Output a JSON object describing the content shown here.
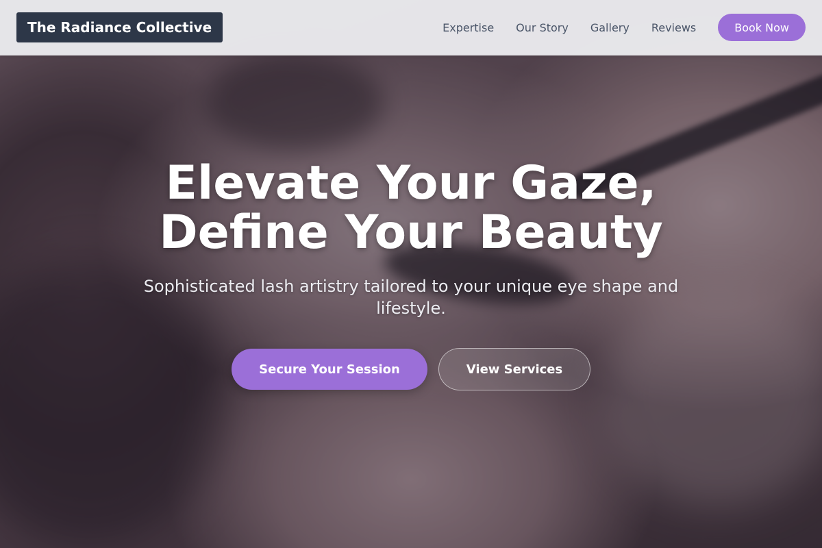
{
  "header": {
    "brand": "The Radiance Collective",
    "nav": [
      {
        "label": "Expertise"
      },
      {
        "label": "Our Story"
      },
      {
        "label": "Gallery"
      },
      {
        "label": "Reviews"
      }
    ],
    "cta_label": "Book Now"
  },
  "hero": {
    "title_line1": "Elevate Your Gaze,",
    "title_line2": "Define Your Beauty",
    "subtitle": "Sophisticated lash artistry tailored to your unique eye shape and lifestyle.",
    "primary_button": "Secure Your Session",
    "secondary_button": "View Services"
  },
  "colors": {
    "accent": "#9b6fd8",
    "brand_bg": "#2d3748",
    "nav_text": "#4a5568",
    "hero_text": "#ffffff"
  }
}
